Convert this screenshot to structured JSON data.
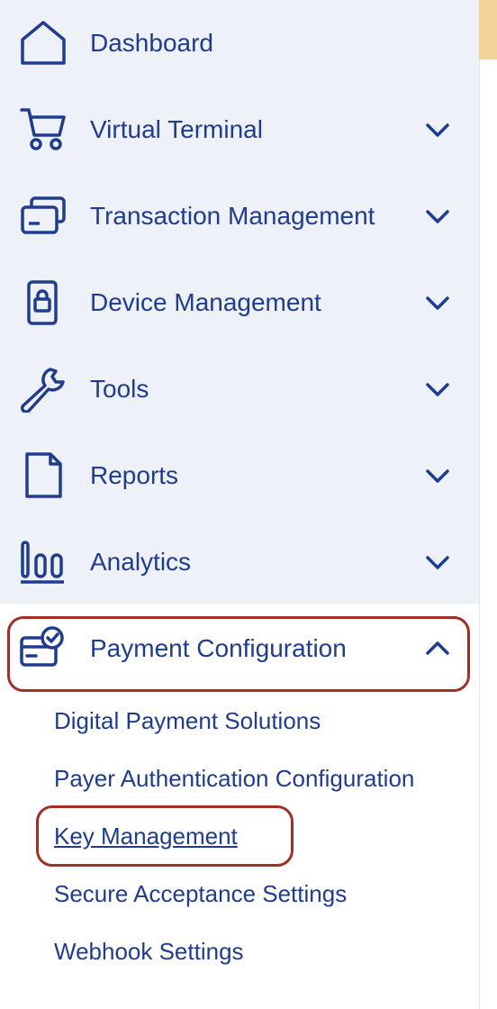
{
  "nav": {
    "items": [
      {
        "label": "Dashboard",
        "icon": "home-icon",
        "expandable": false
      },
      {
        "label": "Virtual Terminal",
        "icon": "cart-icon",
        "expandable": true
      },
      {
        "label": "Transaction Management",
        "icon": "cards-icon",
        "expandable": true
      },
      {
        "label": "Device Management",
        "icon": "device-icon",
        "expandable": true
      },
      {
        "label": "Tools",
        "icon": "wrench-icon",
        "expandable": true
      },
      {
        "label": "Reports",
        "icon": "document-icon",
        "expandable": true
      },
      {
        "label": "Analytics",
        "icon": "bar-chart-icon",
        "expandable": true
      },
      {
        "label": "Payment Configuration",
        "icon": "card-check-icon",
        "expandable": true,
        "expanded": true
      }
    ],
    "payment_configuration_subitems": [
      {
        "label": "Digital Payment Solutions",
        "active": false
      },
      {
        "label": "Payer Authentication Configuration",
        "active": false
      },
      {
        "label": "Key Management",
        "active": true
      },
      {
        "label": "Secure Acceptance Settings",
        "active": false
      },
      {
        "label": "Webhook Settings",
        "active": false
      }
    ]
  },
  "colors": {
    "nav_text": "#1f3c8f",
    "nav_background": "#eef1f8",
    "highlight_outline": "#a03026",
    "scroll_thumb": "#f4d39a"
  }
}
